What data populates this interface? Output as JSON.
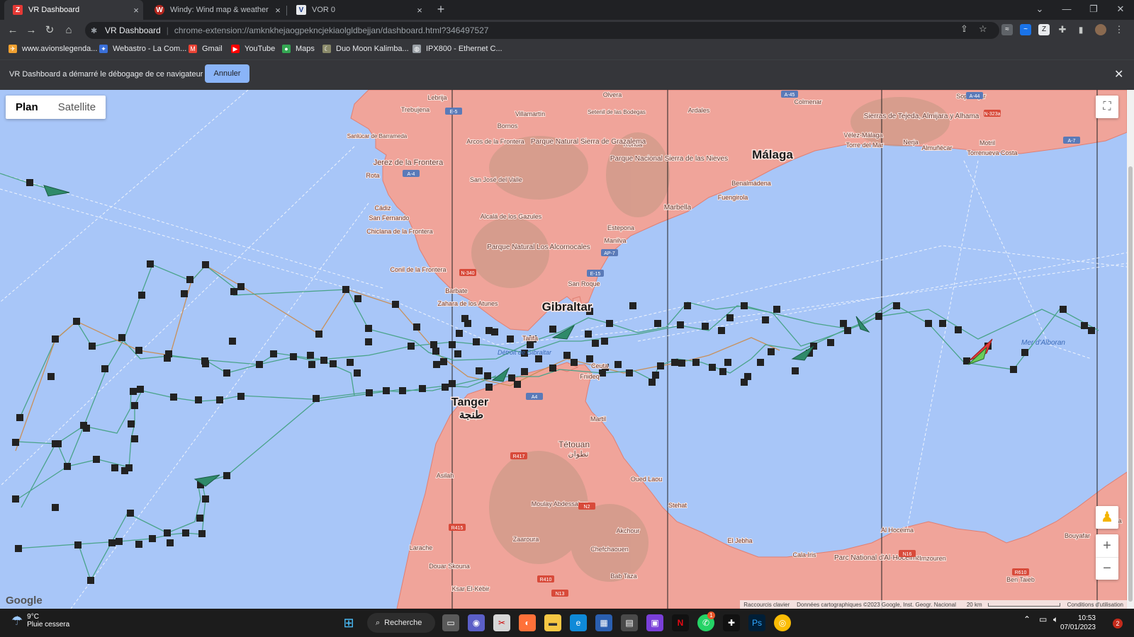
{
  "tabs": [
    {
      "title": "VR Dashboard",
      "favicon": "Z",
      "active": true
    },
    {
      "title": "Windy: Wind map & weather forecast",
      "favicon": "W",
      "active": false
    },
    {
      "title": "VOR 0",
      "favicon": "V",
      "active": false
    }
  ],
  "omnibox": {
    "site_label": "VR Dashboard",
    "url": "chrome-extension://amknkhejaogpekncjekiaolgldbejjan/dashboard.html?346497527"
  },
  "bookmarks": [
    {
      "label": "www.avionslegenda...",
      "icon": "plane-icon",
      "color": "#f0a030"
    },
    {
      "label": "Webastro - La Com...",
      "icon": "telescope-icon",
      "color": "#3a6fd8"
    },
    {
      "label": "Gmail",
      "icon": "gmail-icon",
      "color": "#ea4335"
    },
    {
      "label": "YouTube",
      "icon": "youtube-icon",
      "color": "#ff0000"
    },
    {
      "label": "Maps",
      "icon": "maps-icon",
      "color": "#34a853"
    },
    {
      "label": "Duo Moon Kalimba...",
      "icon": "moon-icon",
      "color": "#8a8a6a"
    },
    {
      "label": "IPX800 - Ethernet C...",
      "icon": "globe-icon",
      "color": "#9aa0a6"
    }
  ],
  "infobar": {
    "message": "VR Dashboard a démarré le débogage de ce navigateur",
    "cancel_label": "Annuler"
  },
  "map": {
    "type_plan": "Plan",
    "type_satellite": "Satellite",
    "selected_type": "Plan",
    "attribution": {
      "shortcuts": "Raccourcis clavier",
      "data": "Données cartographiques ©2023 Google, Inst. Geogr. Nacional",
      "scale": "20 km",
      "terms": "Conditions d'utilisation"
    },
    "google_logo": "Google",
    "places": [
      {
        "name": "Gibraltar",
        "major": true
      },
      {
        "name": "Málaga",
        "major": true
      },
      {
        "name": "Tanger",
        "major": true
      },
      {
        "name": "طنجة",
        "major": true
      },
      {
        "name": "Tétouan",
        "major": false
      },
      {
        "name": "تطوان",
        "major": false
      },
      {
        "name": "Jerez de la Frontera",
        "major": false
      },
      {
        "name": "Cádiz",
        "major": false
      },
      {
        "name": "San Fernando",
        "major": false
      },
      {
        "name": "Chiclana de la Frontera",
        "major": false
      },
      {
        "name": "Conil de la Frontera",
        "major": false
      },
      {
        "name": "Barbate",
        "major": false
      },
      {
        "name": "Zahara de los Atunes",
        "major": false
      },
      {
        "name": "Tarifa",
        "major": false
      },
      {
        "name": "Estepona",
        "major": false
      },
      {
        "name": "Marbella",
        "major": false
      },
      {
        "name": "Fuengirola",
        "major": false
      },
      {
        "name": "Benalmádena",
        "major": false
      },
      {
        "name": "Vélez-Málaga",
        "major": false
      },
      {
        "name": "Torre del Mar",
        "major": false
      },
      {
        "name": "Nerja",
        "major": false
      },
      {
        "name": "Almuñécar",
        "major": false
      },
      {
        "name": "Motril",
        "major": false
      },
      {
        "name": "Torrenueva Costa",
        "major": false
      },
      {
        "name": "Ronda",
        "major": false
      },
      {
        "name": "Olvera",
        "major": false
      },
      {
        "name": "Setenil de las Bodegas",
        "major": false
      },
      {
        "name": "Ardales",
        "major": false
      },
      {
        "name": "Colmenar",
        "major": false
      },
      {
        "name": "Villamartín",
        "major": false
      },
      {
        "name": "Bornos",
        "major": false
      },
      {
        "name": "Arcos de la Frontera",
        "major": false
      },
      {
        "name": "San José del Valle",
        "major": false
      },
      {
        "name": "Alcalá de los Gazules",
        "major": false
      },
      {
        "name": "Manilva",
        "major": false
      },
      {
        "name": "San Roque",
        "major": false
      },
      {
        "name": "Lebrija",
        "major": false
      },
      {
        "name": "Trebujena",
        "major": false
      },
      {
        "name": "Sanlúcar de Barrameda",
        "major": false
      },
      {
        "name": "Rota",
        "major": false
      },
      {
        "name": "Parque Natural Sierra de Grazalema",
        "major": false
      },
      {
        "name": "Parque Nacional Sierra de las Nieves",
        "major": false
      },
      {
        "name": "Parque Natural Los Alcornocales",
        "major": false
      },
      {
        "name": "Sierras de Tejeda, Almijara y Alhama",
        "major": false
      },
      {
        "name": "Fnideq",
        "major": false
      },
      {
        "name": "Ceuta",
        "major": false
      },
      {
        "name": "Martil",
        "major": false
      },
      {
        "name": "Asilah",
        "major": false
      },
      {
        "name": "Larache",
        "major": false
      },
      {
        "name": "Douar Skouna",
        "major": false
      },
      {
        "name": "Ksar El-Kébir",
        "major": false
      },
      {
        "name": "Zaaroura",
        "major": false
      },
      {
        "name": "Moulay Abdessalam",
        "major": false
      },
      {
        "name": "Chefchaouen",
        "major": false
      },
      {
        "name": "Akchour",
        "major": false
      },
      {
        "name": "Bab Taza",
        "major": false
      },
      {
        "name": "Oued Laou",
        "major": false
      },
      {
        "name": "Stehat",
        "major": false
      },
      {
        "name": "El Jebha",
        "major": false
      },
      {
        "name": "Al Hoceima",
        "major": false
      },
      {
        "name": "Parc National d'Al-Hoceima",
        "major": false
      },
      {
        "name": "Imzouren",
        "major": false
      },
      {
        "name": "Ben Taieb",
        "major": false
      },
      {
        "name": "Bouyafar",
        "major": false
      },
      {
        "name": "Melilla",
        "major": false
      },
      {
        "name": "Cala Iris",
        "major": false
      },
      {
        "name": "Soportújar",
        "major": false
      },
      {
        "name": "Mer d'Alboran",
        "major": false,
        "water": true
      },
      {
        "name": "Détroit de Gibraltar",
        "major": false,
        "water": true
      }
    ],
    "road_labels": [
      "A-4",
      "E-5",
      "A-45",
      "A-7",
      "AP-7",
      "E-15",
      "N-340",
      "A-44",
      "N-323a",
      "R417",
      "R415",
      "R410",
      "N2",
      "N13",
      "N16",
      "R610",
      "A4"
    ],
    "colors": {
      "sea": "#a8c6f8",
      "land": "#f0a49a",
      "route_green": "#4aa38a",
      "route_orange": "#c8905a",
      "waypoint": "#222222",
      "boat": "#2f8a6a",
      "boat_red": "#e23a3a"
    }
  },
  "taskbar": {
    "weather_temp": "9°C",
    "weather_desc": "Pluie cessera",
    "search_label": "Recherche",
    "time": "10:53",
    "date": "07/01/2023",
    "notification_count": "2",
    "whatsapp_badge": "1"
  }
}
